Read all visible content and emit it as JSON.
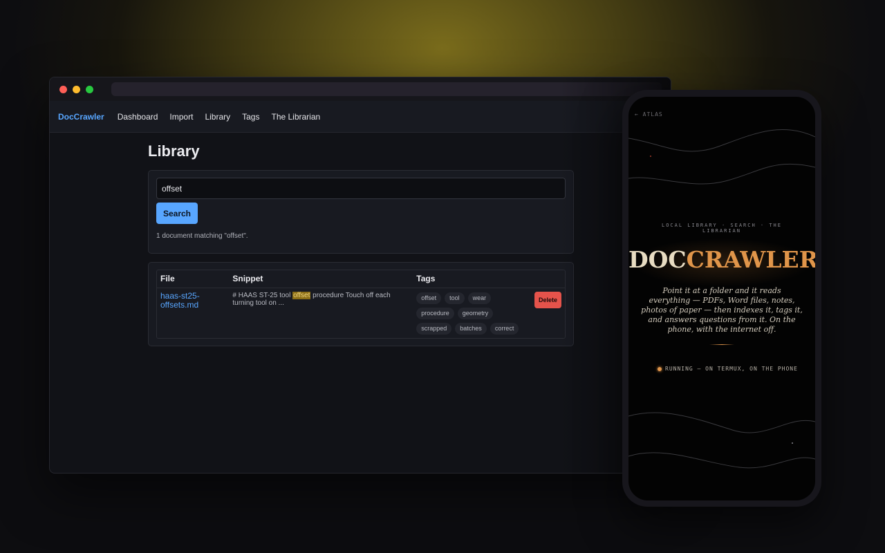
{
  "browser": {
    "nav": {
      "brand": "DocCrawler",
      "links": [
        "Dashboard",
        "Import",
        "Library",
        "Tags",
        "The Librarian"
      ]
    },
    "page_title": "Library",
    "search": {
      "value": "offset",
      "button_label": "Search",
      "result_count": "1 document matching \"offset\"."
    },
    "table": {
      "headers": {
        "file": "File",
        "snippet": "Snippet",
        "tags": "Tags"
      },
      "rows": [
        {
          "file": "haas-st25-offsets.md",
          "snippet_before": "# HAAS ST-25 tool ",
          "snippet_highlight": "offset",
          "snippet_after": " procedure Touch off each turning tool on ...",
          "tags": [
            "offset",
            "tool",
            "wear",
            "procedure",
            "geometry",
            "scrapped",
            "batches",
            "correct"
          ],
          "delete_label": "Delete"
        }
      ]
    }
  },
  "phone": {
    "back_link": "← ATLAS",
    "kicker": "LOCAL LIBRARY · SEARCH · THE LIBRARIAN",
    "headline_part1": "DOC",
    "headline_part2": "CRAWLER",
    "tagline": "Point it at a folder and it reads everything — PDFs, Word files, notes, photos of paper — then indexes it, tags it, and answers questions from it. On the phone, with the internet off.",
    "status": "RUNNING — ON TERMUX, ON THE PHONE",
    "accent_color": "#e0954a"
  },
  "colors": {
    "link": "#58a6ff",
    "danger": "#e5534b",
    "highlight": "#8a6d16"
  }
}
